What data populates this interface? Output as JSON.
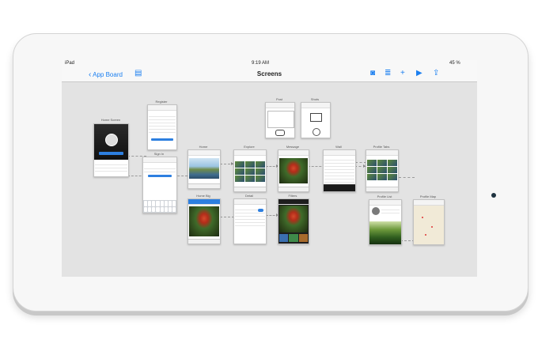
{
  "status_bar": {
    "carrier": "iPad",
    "time": "9:19 AM",
    "battery": "45 %"
  },
  "nav_bar": {
    "back_label": "App Board",
    "title": "Screens"
  },
  "screens": {
    "home": "Home Screen",
    "register": "Register",
    "signin": "Sign In",
    "home_feed": "Home",
    "explore": "Explore",
    "message": "Message",
    "post": "Post",
    "shots": "Shots",
    "wall": "Wall",
    "profile_tabs": "Profile Tabs",
    "profile_list": "Profile List",
    "profile_map": "Profile Map",
    "home_big": "Home Big",
    "detail": "Detail",
    "filters": "Filters"
  },
  "colors": {
    "accent": "#1b7ff0",
    "canvas": "#e3e3e3",
    "device": "#f7f7f7"
  }
}
